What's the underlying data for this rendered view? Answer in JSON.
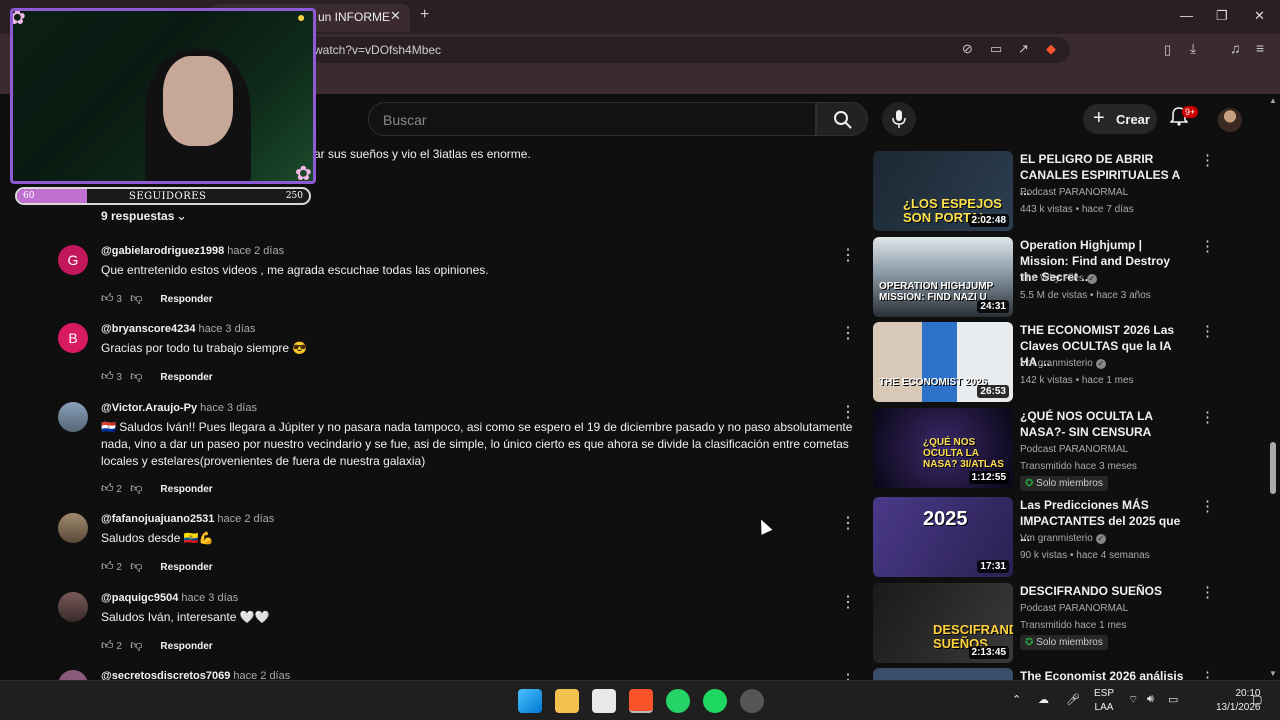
{
  "browser": {
    "tab_title": "un INFORME",
    "tab_close": "✕",
    "new_tab": "+",
    "url": "watch?v=vDOfsh4Mbec",
    "window_controls": [
      "—",
      "❐",
      "✕"
    ]
  },
  "header": {
    "search_placeholder": "Buscar",
    "create_label": "Crear",
    "notif_badge": "9+"
  },
  "overlay": {
    "followers_label": "SEGUIDORES",
    "followers_current": "60",
    "followers_goal": "250",
    "progress_fraction": 0.24
  },
  "comments": {
    "partial_text": "ar sus sueños y vio el 3iatlas es enorme.",
    "replies_label": "9 respuestas",
    "reply_label": "Responder",
    "items": [
      {
        "user": "@gabielarodriguez1998",
        "time": "hace 2 días",
        "text": "Que entretenido estos videos , me agrada escuchae todas las opiniones.",
        "likes": "3",
        "avatar_letter": "G",
        "avatar_color": "#c2185b"
      },
      {
        "user": "@bryanscore4234",
        "time": "hace 3 días",
        "text": "Gracias por todo tu trabajo siempre 😎",
        "likes": "3",
        "avatar_letter": "B",
        "avatar_color": "#d81b60"
      },
      {
        "user": "@Victor.Araujo-Py",
        "time": "hace 3 días",
        "text": "🇵🇾 Saludos Iván!! Pues llegara a Júpiter y no pasara nada tampoco, asi como se espero el 19 de diciembre pasado y no paso absolutamente nada, vino a dar un paseo por nuestro vecindario y se fue, asi de simple, lo único cierto es que ahora se divide la clasificación entre cometas  locales y estelares(provenientes de fuera de nuestra galaxia)",
        "likes": "2",
        "avatar_letter": "",
        "avatar_color": "#6b7b8c"
      },
      {
        "user": "@fafanojuajuano2531",
        "time": "hace 2 días",
        "text": "Saludos desde 🇪🇨💪",
        "likes": "2",
        "avatar_letter": "",
        "avatar_color": "#7a6a5a"
      },
      {
        "user": "@paquigc9504",
        "time": "hace 3 días",
        "text": "Saludos Iván, interesante 🤍🤍",
        "likes": "2",
        "avatar_letter": "",
        "avatar_color": "#5a4a4a"
      },
      {
        "user": "@secretosdiscretos7069",
        "time": "hace 2 días",
        "text": "",
        "likes": "",
        "avatar_letter": "",
        "avatar_color": "#8a5a7a"
      }
    ]
  },
  "sidebar": {
    "videos": [
      {
        "title": "EL PELIGRO DE ABRIR CANALES ESPIRITUALES A ...",
        "channel": "Podcast PARANORMAL",
        "meta": "443 k vistas • hace 7 días",
        "duration": "2:02:48",
        "caption": "¿LOS ESPEJOS SON PORTAL",
        "bg": "#2c3e50",
        "members": ""
      },
      {
        "title": "Operation Highjump | Mission: Find and Destroy the Secret ...",
        "channel": "The Why Files",
        "meta": "5.5 M de vistas • hace 3 años",
        "duration": "24:31",
        "caption": "OPERATION HIGHJUMP MISSION: FIND NAZI U",
        "bg": "#6b7b86",
        "members": ""
      },
      {
        "title": "THE ECONOMIST 2026 Las Claves OCULTAS que la IA HA ...",
        "channel": "Vm granmisterio",
        "meta": "142 k vistas • hace 1 mes",
        "duration": "26:53",
        "caption": "THE ECONOMIST 2026",
        "bg": "#3a4d6a",
        "members": ""
      },
      {
        "title": "¿QUÉ NOS OCULTA LA NASA?- SIN CENSURA",
        "channel": "Podcast PARANORMAL",
        "meta": "Transmitido hace 3 meses",
        "duration": "1:12:55",
        "caption": "¿QUÉ NOS OCULTA LA NASA? 3I/ATLAS",
        "bg": "#1a1230",
        "members": "Solo miembros"
      },
      {
        "title": "Las Predicciones MÁS IMPACTANTES del 2025 que ...",
        "channel": "Vm granmisterio",
        "meta": "90 k vistas • hace 4 semanas",
        "duration": "17:31",
        "caption": "2025",
        "bg": "#3b2f6e",
        "members": ""
      },
      {
        "title": "DESCIFRANDO SUEÑOS",
        "channel": "Podcast PARANORMAL",
        "meta": "Transmitido hace 1 mes",
        "duration": "2:13:45",
        "caption": "DESCIFRANDO SUEÑOS",
        "bg": "#2a2a2a",
        "members": "Solo miembros"
      },
      {
        "title": "The Economist 2026 análisis",
        "channel": "",
        "meta": "",
        "duration": "",
        "caption": "",
        "bg": "#3a4d6a",
        "members": ""
      }
    ]
  },
  "taskbar": {
    "lang_top": "ESP",
    "lang_bottom": "LAA",
    "time": "20:10",
    "date": "13/1/2026"
  },
  "colors": {
    "accent_red": "#cc0000",
    "overlay_border": "#8e5ad6",
    "members_green": "#2ba640"
  }
}
